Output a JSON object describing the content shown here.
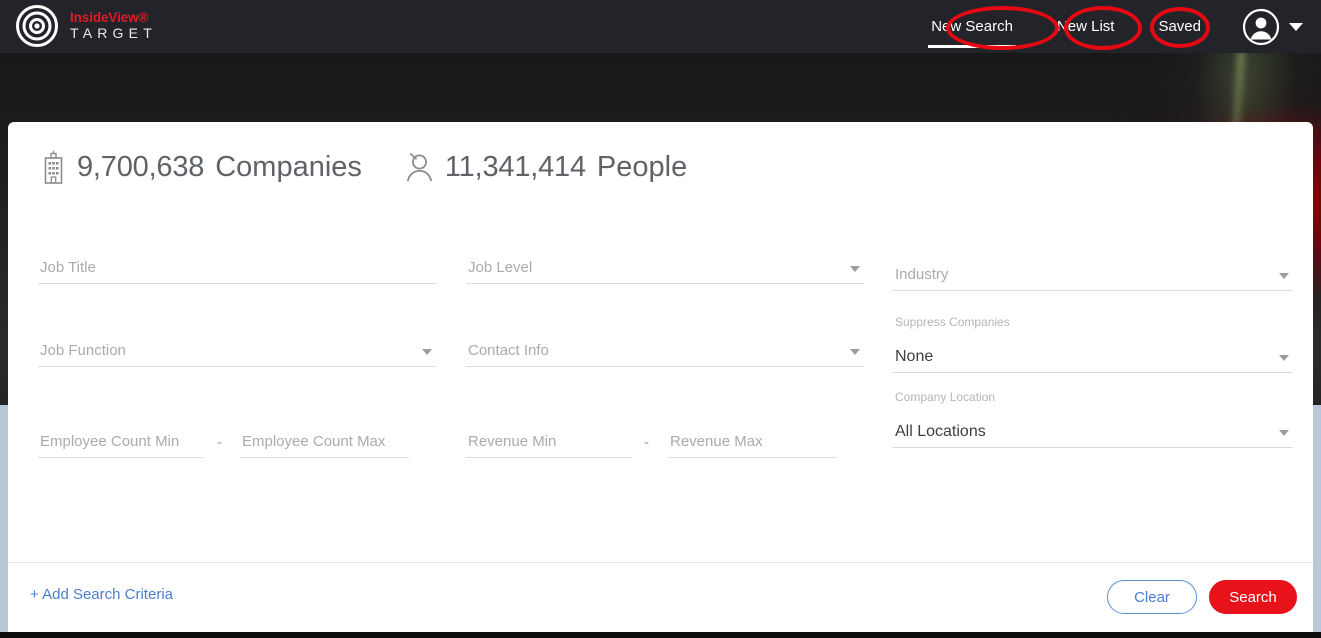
{
  "brand": {
    "name": "InsideView®",
    "sub": "TARGET",
    "logo_icon": "bullseye-target-icon"
  },
  "topnav": {
    "items": [
      {
        "label": "New Search",
        "active": true
      },
      {
        "label": "New List",
        "active": false
      },
      {
        "label": "Saved",
        "active": false
      }
    ],
    "avatar_icon": "user-avatar-icon",
    "caret_icon": "chevron-down-icon"
  },
  "annotations": {
    "style": "red-ellipse-highlight",
    "color": "#e50914",
    "targets": [
      "New Search",
      "New List",
      "Saved"
    ]
  },
  "counts": {
    "companies": {
      "icon": "building-icon",
      "value": "9,700,638",
      "label": "Companies"
    },
    "people": {
      "icon": "person-icon",
      "value": "11,341,414",
      "label": "People"
    }
  },
  "form": {
    "job_title": {
      "placeholder": "Job Title"
    },
    "job_level": {
      "placeholder": "Job Level"
    },
    "industry": {
      "placeholder": "Industry"
    },
    "job_function": {
      "placeholder": "Job Function"
    },
    "contact_info": {
      "placeholder": "Contact Info"
    },
    "suppress_companies": {
      "label": "Suppress Companies",
      "value": "None"
    },
    "employee_count_min": {
      "placeholder": "Employee Count Min"
    },
    "employee_count_max": {
      "placeholder": "Employee Count Max"
    },
    "revenue_min": {
      "placeholder": "Revenue Min"
    },
    "revenue_max": {
      "placeholder": "Revenue Max"
    },
    "company_location": {
      "label": "Company Location",
      "value": "All Locations"
    },
    "range_separator": "-"
  },
  "footer": {
    "add_criteria": "+ Add Search Criteria",
    "clear_label": "Clear",
    "search_label": "Search"
  },
  "colors": {
    "topbar_bg": "#22242a",
    "brand_red": "#e01b24",
    "search_red": "#e8121a",
    "link_blue": "#4a7fd0",
    "page_blue_gray": "#b8c8d8",
    "annotation_red": "#e50914"
  }
}
